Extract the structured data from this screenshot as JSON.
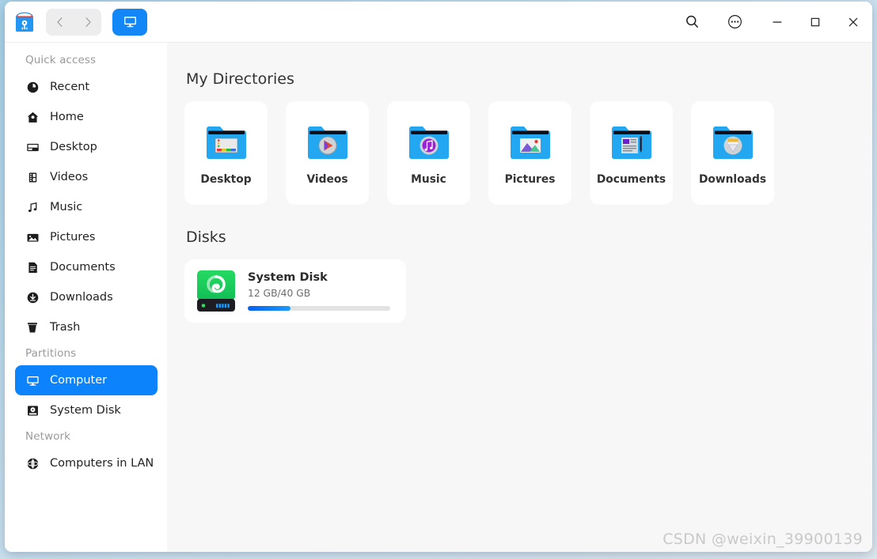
{
  "window": {
    "app_icon": "file-manager-icon",
    "nav": {
      "back": "chevron-left-icon",
      "forward": "chevron-right-icon"
    },
    "active_tab_icon": "computer-icon",
    "controls": {
      "search": "search-icon",
      "more": "more-options-icon",
      "minimize": "minimize-icon",
      "maximize": "maximize-icon",
      "close": "close-icon"
    }
  },
  "sidebar": {
    "groups": [
      {
        "label": "Quick access",
        "items": [
          {
            "label": "Recent",
            "icon": "clock-icon",
            "active": false
          },
          {
            "label": "Home",
            "icon": "home-icon",
            "active": false
          },
          {
            "label": "Desktop",
            "icon": "desktop-icon",
            "active": false
          },
          {
            "label": "Videos",
            "icon": "film-icon",
            "active": false
          },
          {
            "label": "Music",
            "icon": "music-note-icon",
            "active": false
          },
          {
            "label": "Pictures",
            "icon": "picture-icon",
            "active": false
          },
          {
            "label": "Documents",
            "icon": "document-icon",
            "active": false
          },
          {
            "label": "Downloads",
            "icon": "download-icon",
            "active": false
          },
          {
            "label": "Trash",
            "icon": "trash-icon",
            "active": false
          }
        ]
      },
      {
        "label": "Partitions",
        "items": [
          {
            "label": "Computer",
            "icon": "computer-icon",
            "active": true
          },
          {
            "label": "System Disk",
            "icon": "harddisk-icon",
            "active": false
          }
        ]
      },
      {
        "label": "Network",
        "items": [
          {
            "label": "Computers in LAN",
            "icon": "network-globe-icon",
            "active": false
          }
        ]
      }
    ]
  },
  "main": {
    "directories_title": "My Directories",
    "directories": [
      {
        "label": "Desktop",
        "icon": "folder-desktop-icon"
      },
      {
        "label": "Videos",
        "icon": "folder-videos-icon"
      },
      {
        "label": "Music",
        "icon": "folder-music-icon"
      },
      {
        "label": "Pictures",
        "icon": "folder-pictures-icon"
      },
      {
        "label": "Documents",
        "icon": "folder-documents-icon"
      },
      {
        "label": "Downloads",
        "icon": "folder-downloads-icon"
      }
    ],
    "disks_title": "Disks",
    "disks": [
      {
        "name": "System Disk",
        "capacity_label": "12 GB/40 GB",
        "used_percent": 30,
        "icon": "harddisk-green-icon"
      }
    ]
  },
  "watermark": "CSDN @weixin_39900139",
  "colors": {
    "accent": "#0c82fb",
    "sidebar_bg": "#ffffff",
    "content_bg": "#f7f7f7",
    "card_bg": "#ffffff",
    "folder_blue": "#22a7f0",
    "disk_green": "#1bc94e",
    "progress_start": "#0560ef",
    "progress_end": "#1c9bfb"
  }
}
